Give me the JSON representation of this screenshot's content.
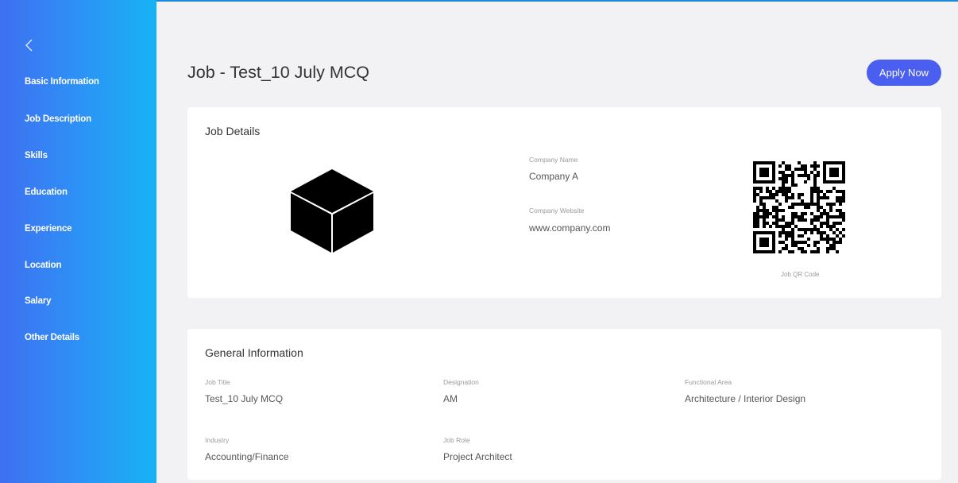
{
  "sidebar": {
    "back_icon": "chevron-left-icon",
    "items": [
      {
        "label": "Basic Information"
      },
      {
        "label": "Job Description"
      },
      {
        "label": "Skills"
      },
      {
        "label": "Education"
      },
      {
        "label": "Experience"
      },
      {
        "label": "Location"
      },
      {
        "label": "Salary"
      },
      {
        "label": "Other Details"
      }
    ]
  },
  "header": {
    "title": "Job - Test_10 July MCQ",
    "apply_label": "Apply Now"
  },
  "job_details": {
    "title": "Job Details",
    "logo_icon": "cube-icon",
    "company_name_label": "Company Name",
    "company_name": "Company A",
    "company_website_label": "Company Website",
    "company_website": "www.company.com",
    "qr_caption": "Job QR Code"
  },
  "general_info": {
    "title": "General Information",
    "job_title_label": "Job Title",
    "job_title": "Test_10 July MCQ",
    "designation_label": "Designation",
    "designation": "AM",
    "functional_area_label": "Functional Area",
    "functional_area": "Architecture / Interior Design",
    "industry_label": "Industry",
    "industry": "Accounting/Finance",
    "job_role_label": "Job Role",
    "job_role": "Project Architect"
  },
  "colors": {
    "sidebar_gradient_start": "#3f6ff1",
    "sidebar_gradient_end": "#17b3f4",
    "accent_button": "#4a5ef0",
    "page_background": "#f2f2f4"
  }
}
